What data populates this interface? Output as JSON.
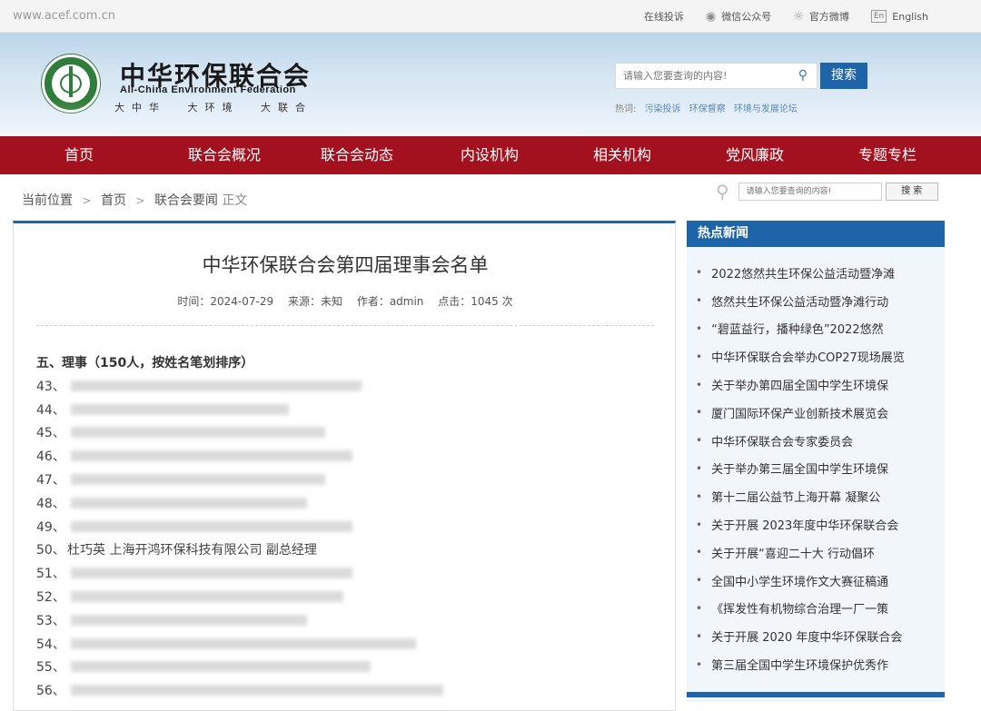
{
  "topbar": {
    "url": "www.acef.com.cn",
    "links": [
      {
        "icon": "complaint-icon",
        "label": "在线投诉"
      },
      {
        "icon": "wechat-icon",
        "label": "微信公众号"
      },
      {
        "icon": "weibo-icon",
        "label": "官方微博"
      },
      {
        "icon": "english-icon",
        "label": "English"
      }
    ]
  },
  "header": {
    "logo_cn": "中华环保联合会",
    "logo_en": "All-China Environment Federation",
    "slogan": "大中华 大环境 大联合",
    "search_placeholder": "请输入您要查询的内容!",
    "search_button": "搜索",
    "hot_label": "热词:",
    "hot_words": [
      "污染投诉",
      "环保督察",
      "环境与发展论坛"
    ]
  },
  "nav": [
    "首页",
    "联合会概况",
    "联合会动态",
    "内设机构",
    "相关机构",
    "党风廉政",
    "专题专栏"
  ],
  "breadcrumb": {
    "label": "当前位置",
    "items": [
      "首页",
      "联合会要闻"
    ],
    "current": "正文",
    "search_placeholder": "请输入您要查询的内容!",
    "search_button": "搜 索"
  },
  "article": {
    "title": "中华环保联合会第四届理事会名单",
    "meta": {
      "time": "时间：2024-07-29",
      "source": "来源：未知",
      "author": "作者：admin",
      "clicks": "点击：1045 次"
    },
    "section": "五、理事（150人，按姓名笔划排序）",
    "rows": [
      {
        "num": "43、",
        "text": ""
      },
      {
        "num": "44、",
        "text": ""
      },
      {
        "num": "45、",
        "text": ""
      },
      {
        "num": "46、",
        "text": ""
      },
      {
        "num": "47、",
        "text": ""
      },
      {
        "num": "48、",
        "text": ""
      },
      {
        "num": "49、",
        "text": ""
      },
      {
        "num": "50、",
        "text": "杜巧英 上海开鸿环保科技有限公司 副总经理"
      },
      {
        "num": "51、",
        "text": ""
      },
      {
        "num": "52、",
        "text": ""
      },
      {
        "num": "53、",
        "text": ""
      },
      {
        "num": "54、",
        "text": ""
      },
      {
        "num": "55、",
        "text": ""
      },
      {
        "num": "56、",
        "text": ""
      }
    ]
  },
  "sidebar": {
    "title": "热点新闻",
    "items": [
      "2022悠然共生环保公益活动暨净滩",
      "悠然共生环保公益活动暨净滩行动",
      "“碧蓝益行，播种绿色”2022悠然",
      "中华环保联合会举办COP27现场展览",
      "关于举办第四届全国中学生环境保",
      "厦门国际环保产业创新技术展览会",
      "中华环保联合会专家委员会",
      "关于举办第三届全国中学生环境保",
      "第十二届公益节上海开幕 凝聚公",
      "关于开展 2023年度中华环保联合会",
      "关于开展“喜迎二十大 行动倡环",
      "全国中小学生环境作文大赛征稿通",
      "《挥发性有机物综合治理一厂一策",
      "关于开展 2020 年度中华环保联合会",
      "第三届全国中学生环境保护优秀作"
    ]
  }
}
